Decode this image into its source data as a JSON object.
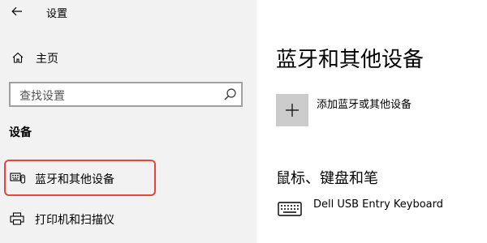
{
  "window": {
    "title": "设置"
  },
  "sidebar": {
    "home_label": "主页",
    "search_placeholder": "查找设置",
    "section_heading": "设备",
    "items": [
      {
        "label": "蓝牙和其他设备",
        "icon": "bluetooth-devices-icon",
        "selected": true
      },
      {
        "label": "打印机和扫描仪",
        "icon": "printer-icon",
        "selected": false
      }
    ]
  },
  "main": {
    "title": "蓝牙和其他设备",
    "add_device_label": "添加蓝牙或其他设备",
    "mouse_keyboard_heading": "鼠标、键盘和笔",
    "devices": [
      {
        "name": "Dell USB Entry Keyboard",
        "icon": "keyboard-icon"
      }
    ]
  },
  "colors": {
    "sidebar_bg": "#f2f2f2",
    "highlight": "#e8453c",
    "add_tile": "#cccccc"
  }
}
